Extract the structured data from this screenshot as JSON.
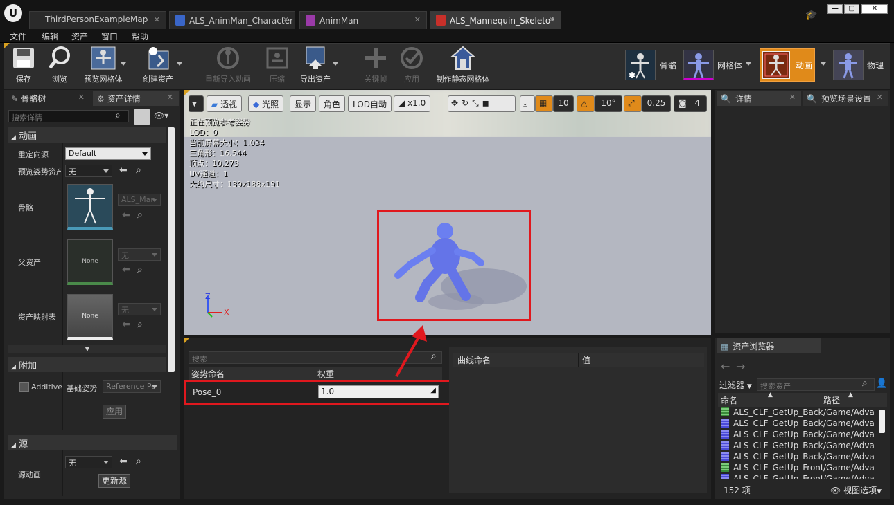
{
  "tabs": [
    {
      "label": "ThirdPersonExampleMap",
      "icon": "map-icon"
    },
    {
      "label": "ALS_AnimMan_Character",
      "icon": "blueprint-icon"
    },
    {
      "label": "AnimMan",
      "icon": "animation-blueprint-icon"
    },
    {
      "label": "ALS_Mannequin_Skeleto*",
      "icon": "skeleton-icon"
    }
  ],
  "menu": [
    "文件",
    "编辑",
    "资产",
    "窗口",
    "帮助"
  ],
  "toolbar": {
    "save": "保存",
    "browse": "浏览",
    "preview_mesh": "预览网格体",
    "create_asset": "创建资产",
    "reimport": "重新导入动画",
    "compress": "压缩",
    "export_asset": "导出资产",
    "keyframe": "关键帧",
    "apply": "应用",
    "make_static_mesh": "制作静态网格体",
    "mode_skeleton": "骨骼",
    "mode_mesh": "网格体",
    "mode_animation": "动画",
    "mode_physics": "物理"
  },
  "left": {
    "tab_skeleton_tree": "骨骼树",
    "tab_asset_details": "资产详情",
    "search_placeholder": "搜索详情",
    "section_animation": "动画",
    "retarget_source_label": "重定向源",
    "retarget_source_value": "Default",
    "preview_pose_label": "预览姿势资产",
    "preview_pose_value": "无",
    "skeleton_label": "骨骼",
    "skeleton_value": "ALS_Man",
    "parent_asset_label": "父资产",
    "parent_asset_thumb": "None",
    "parent_asset_value": "无",
    "asset_mapping_label": "资产映射表",
    "asset_mapping_thumb": "None",
    "asset_mapping_value": "无",
    "section_additive": "附加",
    "additive_label": "Additive",
    "base_pose_label": "基础姿势",
    "base_pose_value": "Reference Po",
    "apply_button": "应用",
    "section_source": "源",
    "source_anim_label": "源动画",
    "source_anim_value": "无",
    "update_source_button": "更新源"
  },
  "viewport": {
    "view_mode": "透视",
    "lighting": "光照",
    "show": "显示",
    "character": "角色",
    "lod_auto": "LOD自动",
    "speed": "x1.0",
    "grid_size": "10",
    "rotation_snap": "10°",
    "scale_snap": "0.25",
    "camera_speed": "4",
    "overlay": [
      "正在预览参考姿势",
      "LOD：0",
      "当前屏幕大小：1.034",
      "三角形：16,544",
      "顶点：10,273",
      "UV通道：1",
      "大约尺寸：139x188x191"
    ],
    "axis_z": "Z",
    "axis_x": "X"
  },
  "pose": {
    "search_placeholder": "搜索",
    "col_pose_name": "姿势命名",
    "col_weight": "权重",
    "rows": [
      {
        "name": "Pose_0",
        "weight": "1.0"
      }
    ],
    "col_curve_name": "曲线命名",
    "col_value": "值"
  },
  "right": {
    "tab_details": "详情",
    "tab_preview_scene": "预览场景设置"
  },
  "content_browser": {
    "tab": "资产浏览器",
    "filter_label": "过滤器",
    "search_placeholder": "搜索资产",
    "col_name": "命名",
    "col_path": "路径",
    "rows": [
      {
        "name": "ALS_CLF_GetUp_Back",
        "path": "/Game/Adva",
        "type": "green"
      },
      {
        "name": "ALS_CLF_GetUp_Back_",
        "path": "/Game/Adva",
        "type": "blue"
      },
      {
        "name": "ALS_CLF_GetUp_Back_",
        "path": "/Game/Adva",
        "type": "blue"
      },
      {
        "name": "ALS_CLF_GetUp_Back_",
        "path": "/Game/Adva",
        "type": "blue"
      },
      {
        "name": "ALS_CLF_GetUp_Back_",
        "path": "/Game/Adva",
        "type": "blue"
      },
      {
        "name": "ALS_CLF_GetUp_Front",
        "path": "/Game/Adva",
        "type": "green"
      },
      {
        "name": "ALS_CLF_GetUp_Front_",
        "path": "/Game/Adva",
        "type": "blue"
      }
    ],
    "item_count": "152 项",
    "view_options": "视图选项"
  },
  "colors": {
    "highlight_red": "#e0181e",
    "active_mode": "#e08a1a",
    "mannequin": "#6b7ff0"
  }
}
